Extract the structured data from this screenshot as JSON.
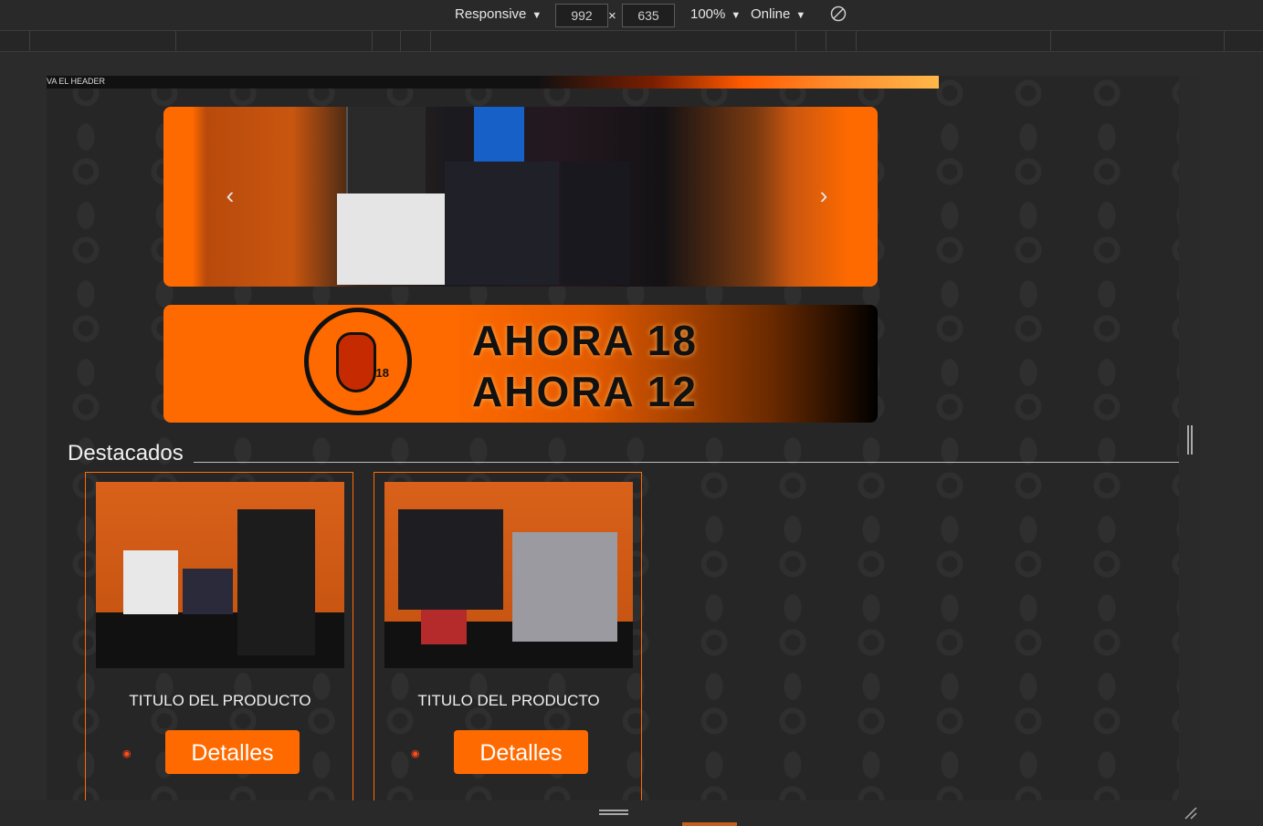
{
  "devtools": {
    "device": "Responsive",
    "width": "992",
    "height": "635",
    "zoom": "100%",
    "network": "Online",
    "times": "×"
  },
  "page": {
    "header_label": "VA EL HEADER",
    "carousel": {
      "prev": "‹",
      "next": "›"
    },
    "promo": {
      "line1": "AHORA 18",
      "line2": "AHORA 12",
      "logo_number": "18"
    },
    "featured": {
      "title": "Destacados",
      "products": [
        {
          "title": "TITULO DEL PRODUCTO",
          "button": "Detalles"
        },
        {
          "title": "TITULO DEL PRODUCTO",
          "button": "Detalles"
        }
      ]
    }
  },
  "colors": {
    "accent": "#ff6a00",
    "bg": "#262626"
  }
}
